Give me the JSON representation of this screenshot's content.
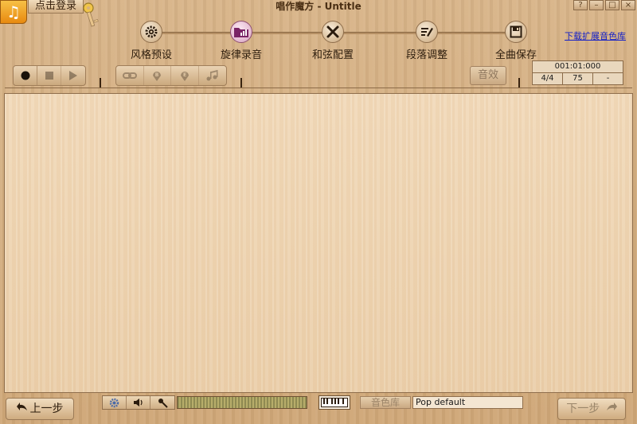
{
  "window": {
    "title": "唱作魔方 - Untitle",
    "buttons": [
      "?",
      "–",
      "□",
      "×"
    ]
  },
  "header": {
    "logo_glyph": "♫",
    "login_label": "点击登录",
    "download_link": "下载扩展音色库"
  },
  "steps": [
    {
      "label": "风格预设",
      "icon": "gear-icon",
      "active": false
    },
    {
      "label": "旋律录音",
      "icon": "folder-chart-icon",
      "active": true
    },
    {
      "label": "和弦配置",
      "icon": "tools-icon",
      "active": false
    },
    {
      "label": "段落调整",
      "icon": "edit-icon",
      "active": false
    },
    {
      "label": "全曲保存",
      "icon": "save-icon",
      "active": false
    }
  ],
  "toolbar": {
    "transport": [
      "record-icon",
      "stop-icon",
      "play-icon"
    ],
    "edit_tools": [
      "link-icon",
      "marker-b-icon",
      "marker-e-icon",
      "notes-icon"
    ],
    "effects_label": "音效"
  },
  "position": {
    "time": "001:01:000",
    "meter": "4/4",
    "tempo": "75",
    "key": "-"
  },
  "bottom": {
    "prev_label": "上一步",
    "next_label": "下一步",
    "mini_tools": [
      "settings-icon",
      "volume-icon",
      "mic-icon"
    ],
    "level": 0.0,
    "tone_lib_label": "音色库",
    "tone_value": "Pop default"
  },
  "colors": {
    "wood_light": "#f1d9b9",
    "wood_dark": "#cfa777",
    "link": "#1420c8",
    "logo": "#e88a10"
  }
}
